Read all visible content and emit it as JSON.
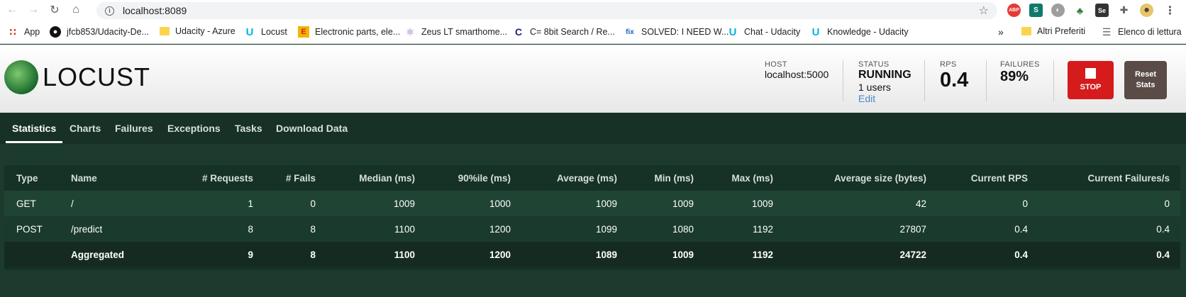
{
  "browser": {
    "url": "localhost:8089",
    "bookmarks": [
      {
        "label": "App",
        "icon": "apps-grid-icon"
      },
      {
        "label": "jfcb853/Udacity-De...",
        "icon": "github-icon"
      },
      {
        "label": "Udacity - Azure",
        "icon": "folder-icon"
      },
      {
        "label": "Locust",
        "icon": "udacity-icon"
      },
      {
        "label": "Electronic parts, ele...",
        "icon": "electronic-parts-icon"
      },
      {
        "label": "Zeus LT smarthome...",
        "icon": "atom-icon"
      },
      {
        "label": "C= 8bit Search / Re...",
        "icon": "commodore-icon"
      },
      {
        "label": "SOLVED: I NEED W...",
        "icon": "fixya-icon"
      },
      {
        "label": "Chat - Udacity",
        "icon": "udacity-icon"
      },
      {
        "label": "Knowledge - Udacity",
        "icon": "udacity-icon"
      }
    ],
    "bookmarks_overflow": "»",
    "other_bookmarks": "Altri Preferiti",
    "reading_list": "Elenco di lettura"
  },
  "header": {
    "logo_text": "LOCUST",
    "host_label": "HOST",
    "host_value": "localhost:5000",
    "status_label": "STATUS",
    "status_value": "RUNNING",
    "users_text": "1 users",
    "edit_label": "Edit",
    "rps_label": "RPS",
    "rps_value": "0.4",
    "failures_label": "FAILURES",
    "failures_value": "89%",
    "stop_label": "STOP",
    "reset_label_1": "Reset",
    "reset_label_2": "Stats"
  },
  "tabs": [
    "Statistics",
    "Charts",
    "Failures",
    "Exceptions",
    "Tasks",
    "Download Data"
  ],
  "table": {
    "columns": [
      "Type",
      "Name",
      "# Requests",
      "# Fails",
      "Median (ms)",
      "90%ile (ms)",
      "Average (ms)",
      "Min (ms)",
      "Max (ms)",
      "Average size (bytes)",
      "Current RPS",
      "Current Failures/s"
    ],
    "rows": [
      [
        "GET",
        "/",
        "1",
        "0",
        "1009",
        "1000",
        "1009",
        "1009",
        "1009",
        "42",
        "0",
        "0"
      ],
      [
        "POST",
        "/predict",
        "8",
        "8",
        "1100",
        "1200",
        "1099",
        "1080",
        "1192",
        "27807",
        "0.4",
        "0.4"
      ]
    ],
    "aggregated": [
      "",
      "Aggregated",
      "9",
      "8",
      "1100",
      "1200",
      "1089",
      "1009",
      "1192",
      "24722",
      "0.4",
      "0.4"
    ]
  }
}
